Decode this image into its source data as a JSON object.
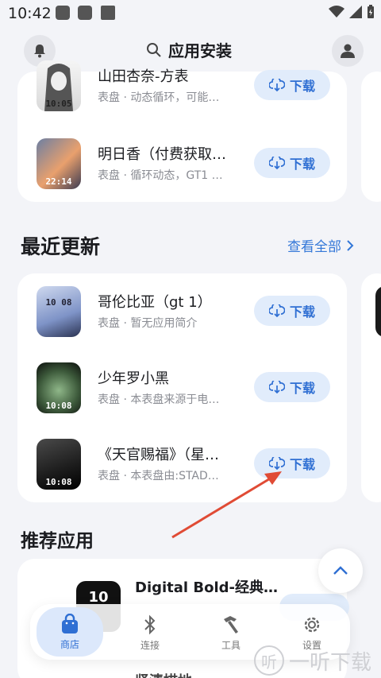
{
  "status": {
    "time": "10:42"
  },
  "header": {
    "title": "应用安装"
  },
  "top_list": [
    {
      "name": "山田杏奈-方表",
      "desc": "表盘 · 动态循环，可能…",
      "thumb_time": "10:05"
    },
    {
      "name": "明日香（付费获取…",
      "desc": "表盘 · 循环动态，GT1 …",
      "thumb_time": "22:14"
    }
  ],
  "recent": {
    "title": "最近更新",
    "see_all": "查看全部",
    "items": [
      {
        "name": "哥伦比亚（gt 1）",
        "desc": "表盘 · 暂无应用简介",
        "thumb_time": "10 08"
      },
      {
        "name": "少年罗小黑",
        "desc": "表盘 · 本表盘来源于电…",
        "thumb_time": "10:08"
      },
      {
        "name": "《天官赐福》（星…",
        "desc": "表盘 · 本表盘由:STAD…",
        "thumb_time": "10:08"
      }
    ]
  },
  "recommended": {
    "title": "推荐应用",
    "items": [
      {
        "name": "Digital Bold-经典…",
        "thumb_time": "10"
      }
    ],
    "partial_label": "肾清描地"
  },
  "download_label": "下载",
  "nav": [
    {
      "label": "商店",
      "icon": "bag-icon"
    },
    {
      "label": "连接",
      "icon": "bluetooth-icon"
    },
    {
      "label": "工具",
      "icon": "hammer-icon"
    },
    {
      "label": "设置",
      "icon": "gear-icon"
    }
  ],
  "watermark": {
    "text": "一听下载",
    "glyph": "听"
  },
  "colors": {
    "accent": "#2f6fd3",
    "button_bg": "#e1ecfb",
    "background": "#f3f4f8",
    "annotation_arrow": "#e04b35"
  }
}
